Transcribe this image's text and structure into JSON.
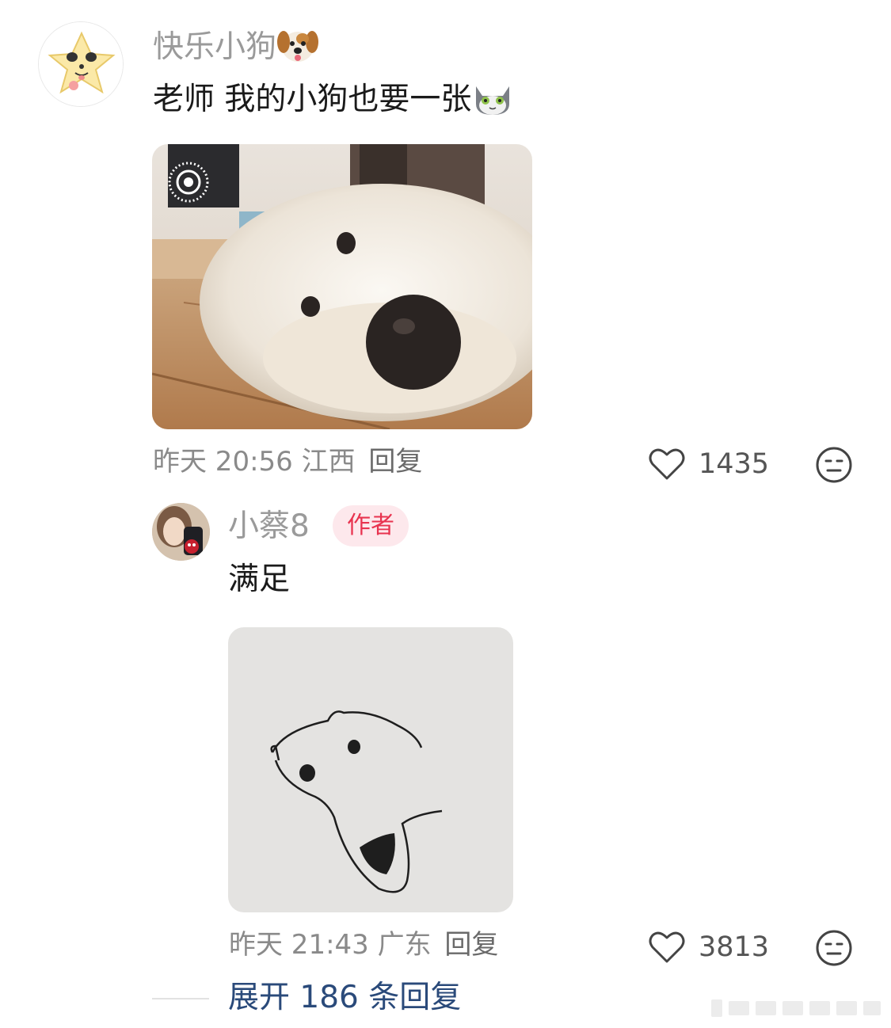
{
  "comment": {
    "username": "快乐小狗",
    "username_emoji": "dog-face-emoji",
    "text": "老师 我的小狗也要一张",
    "text_emoji": "cat-face-emoji",
    "photo": "samoyed-photo",
    "timestamp": "昨天 20:56",
    "location": "江西",
    "reply_label": "回复",
    "like_count": "1435",
    "like_icon": "heart-outline-icon",
    "react_icon": "neutral-face-icon"
  },
  "reply": {
    "username": "小蔡8",
    "badge": "作者",
    "text": "满足",
    "photo": "dog-sketch-drawing",
    "timestamp": "昨天 21:43",
    "location": "广东",
    "reply_label": "回复",
    "like_count": "3813",
    "like_icon": "heart-outline-icon",
    "react_icon": "neutral-face-icon"
  },
  "expand_replies": "展开 186 条回复",
  "colors": {
    "username": "#9a9a9a",
    "badge_bg": "#fde8ec",
    "badge_text": "#e8334f",
    "expand_link": "#2a4a7a",
    "meta": "#8a8a8a"
  }
}
